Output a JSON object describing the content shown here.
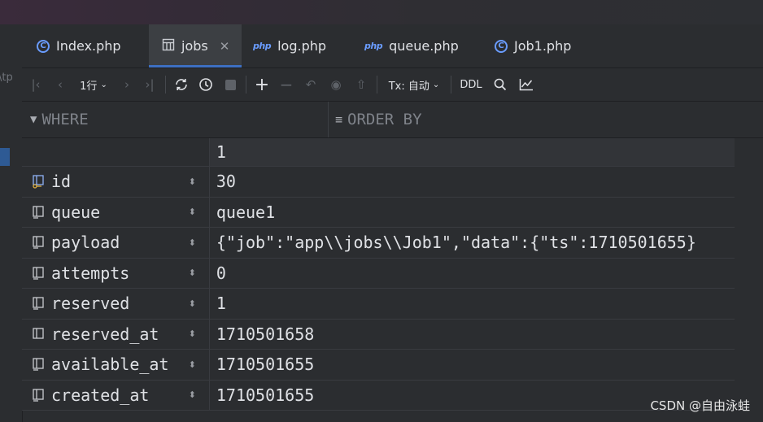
{
  "left_fragment": "\\tp",
  "tabs": [
    {
      "label": "Index.php",
      "icon": "class-c-icon"
    },
    {
      "label": "jobs",
      "icon": "table-icon",
      "active": true
    },
    {
      "label": "log.php",
      "icon": "php-file-icon"
    },
    {
      "label": "queue.php",
      "icon": "php-file-icon"
    },
    {
      "label": "Job1.php",
      "icon": "class-c-icon"
    }
  ],
  "toolbar": {
    "page_label": "1行",
    "tx_label": "Tx: 自动",
    "ddl_label": "DDL"
  },
  "filters": {
    "where": "WHERE",
    "order_by": "ORDER BY"
  },
  "grid": {
    "column_header": "1",
    "rows": [
      {
        "name": "id",
        "value": "30",
        "key": true
      },
      {
        "name": "queue",
        "value": "queue1"
      },
      {
        "name": "payload",
        "value": "{\"job\":\"app\\\\jobs\\\\Job1\",\"data\":{\"ts\":1710501655}"
      },
      {
        "name": "attempts",
        "value": "0"
      },
      {
        "name": "reserved",
        "value": "1"
      },
      {
        "name": "reserved_at",
        "value": "1710501658"
      },
      {
        "name": "available_at",
        "value": "1710501655"
      },
      {
        "name": "created_at",
        "value": "1710501655"
      }
    ]
  },
  "watermark": "CSDN @自由泳蛙",
  "colors": {
    "background": "#2b2d30",
    "accent": "#3d6fc1",
    "icon_blue": "#6a9cff"
  }
}
